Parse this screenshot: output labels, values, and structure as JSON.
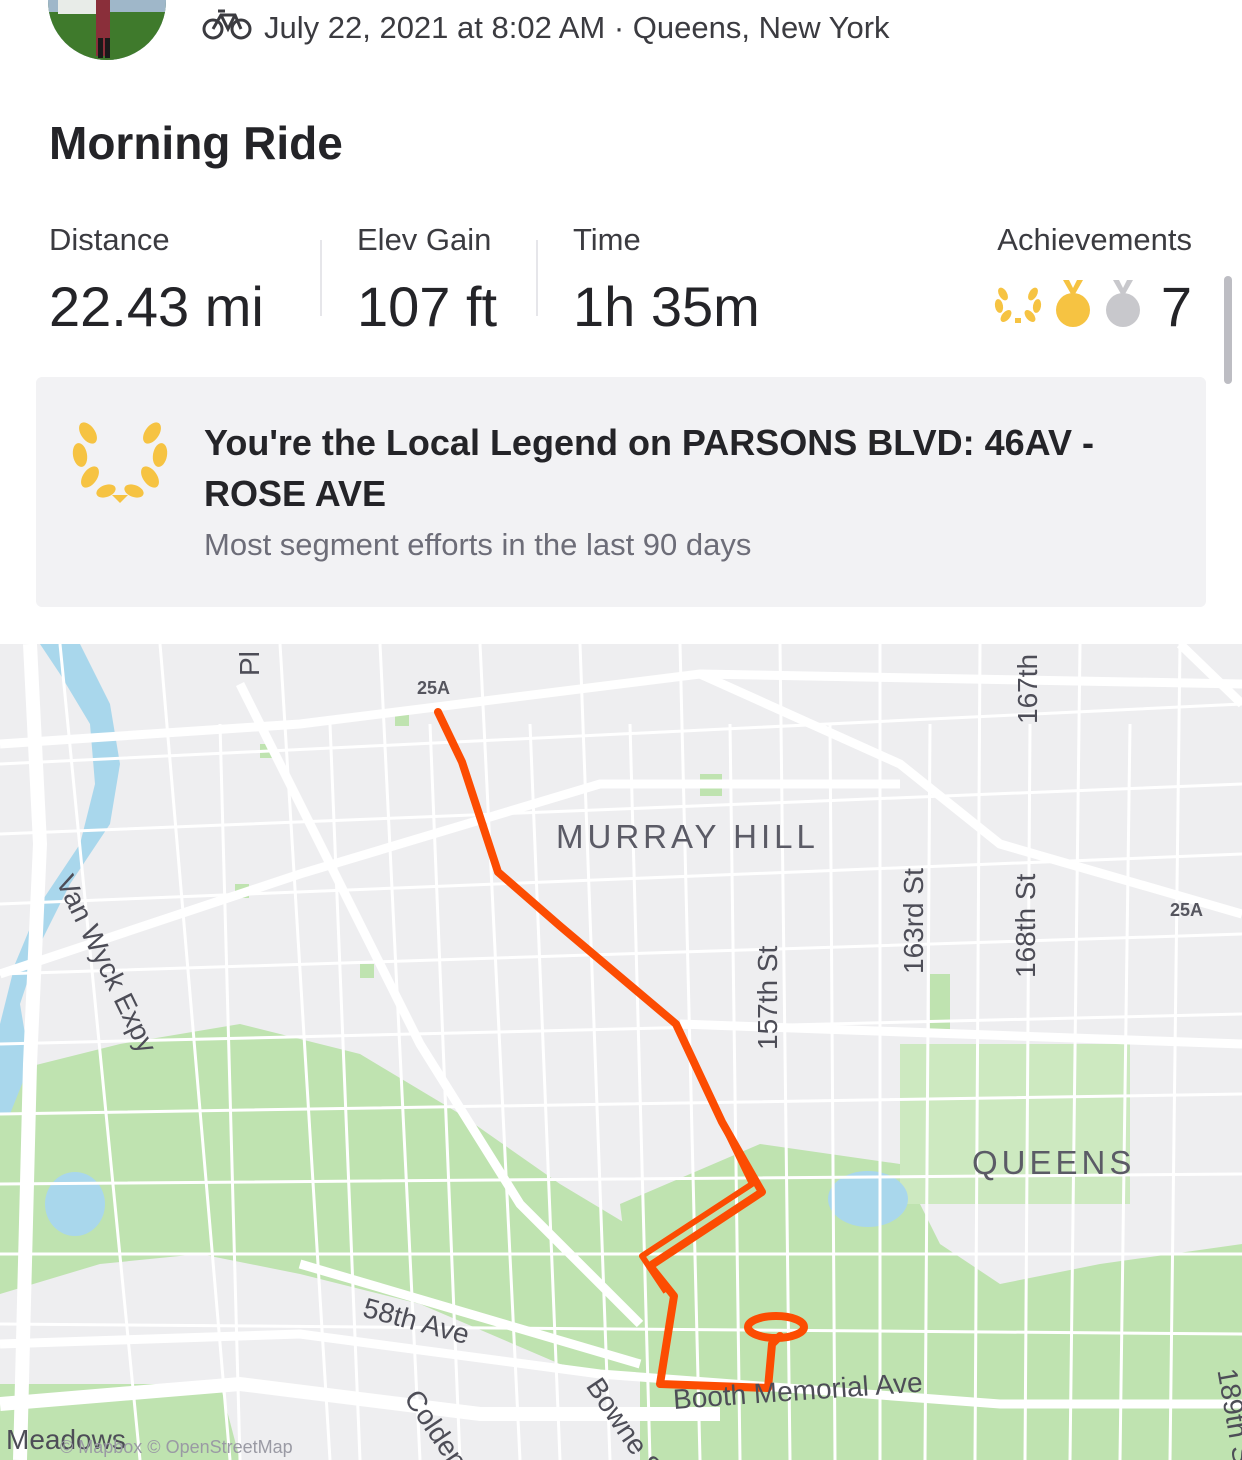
{
  "activity": {
    "meta_text": "July 22, 2021 at 8:02 AM · Queens, New York",
    "title": "Morning Ride"
  },
  "stats": [
    {
      "label": "Distance",
      "value": "22.43 mi"
    },
    {
      "label": "Elev Gain",
      "value": "107 ft"
    },
    {
      "label": "Time",
      "value": "1h 35m"
    }
  ],
  "achievements": {
    "label": "Achievements",
    "count": "7",
    "icons": [
      "local-legend-wreath-icon",
      "gold-medal-icon",
      "silver-medal-icon"
    ]
  },
  "local_legend": {
    "title": "You're the Local Legend on PARSONS BLVD: 46AV - ROSE AVE",
    "subtitle": "Most segment efforts in the last 90 days"
  },
  "map": {
    "route_color": "#fc4c02",
    "labels": {
      "hw_25a_top": "25A",
      "hw_25a_right": "25A",
      "murray_hill": "MURRAY HILL",
      "queens": "QUEENS",
      "van_wyck": "Van Wyck Expy",
      "colden": "Colden St",
      "bowne": "Bowne St",
      "st_157": "157th St",
      "st_163": "163rd St",
      "st_168": "168th St",
      "st_167": "167th",
      "st_189": "189th S",
      "ave_58": "58th Ave",
      "memorial": "Booth Memorial Ave",
      "meadows": "Meadows",
      "pl": "Pl",
      "attribution": "© Mapbox © OpenStreetMap"
    }
  },
  "colors": {
    "gold": "#f6c342",
    "silver": "#c8c8cc",
    "park": "#bfe3b0",
    "water": "#a9d7ec"
  }
}
